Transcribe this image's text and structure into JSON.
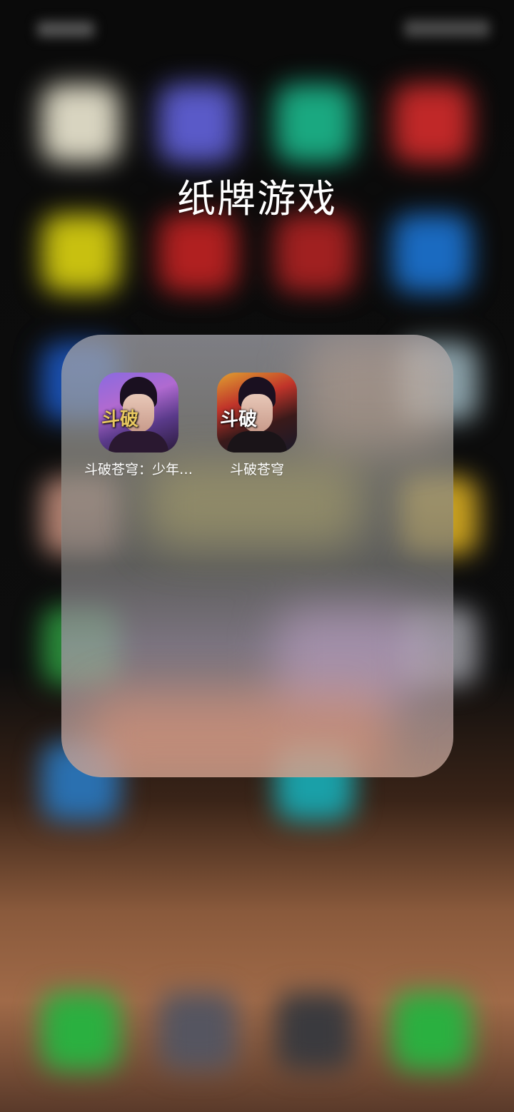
{
  "folder": {
    "title": "纸牌游戏"
  },
  "apps": [
    {
      "label": "斗破苍穹：少年…",
      "icon": "game-icon-doupo-shaonian",
      "logo": "斗破"
    },
    {
      "label": "斗破苍穹",
      "icon": "game-icon-doupo",
      "logo": "斗破"
    }
  ],
  "colors": {
    "panel_tint": "#a8a6a2",
    "title_text": "#ffffff",
    "background": "#0a0a0a"
  }
}
